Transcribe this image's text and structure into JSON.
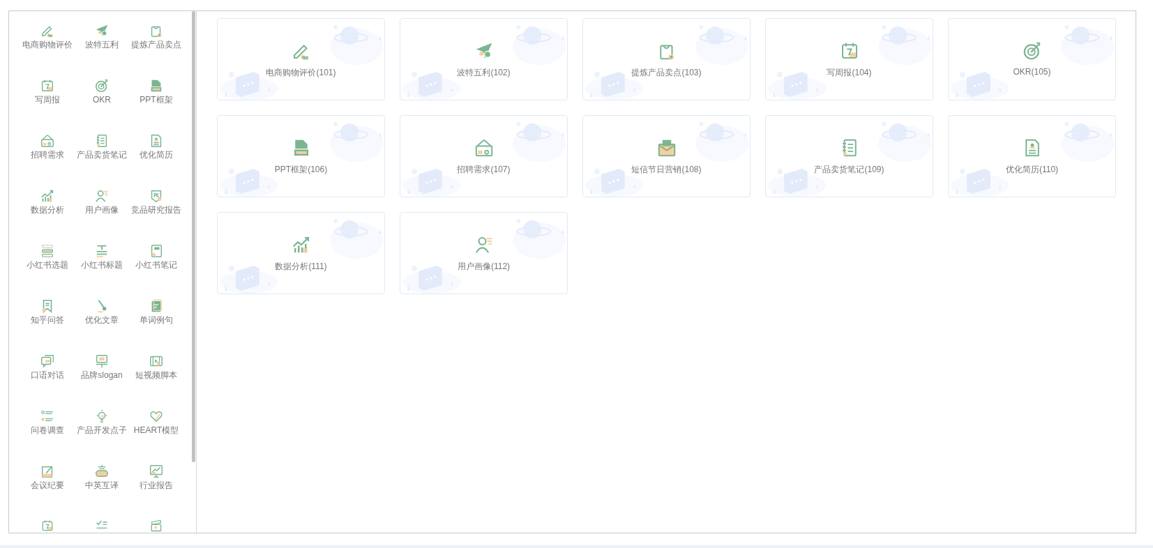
{
  "sidebar": {
    "items": [
      {
        "kind": "full",
        "label": "电商购物评价"
      },
      {
        "kind": "full",
        "label": "波特五利"
      },
      {
        "kind": "full",
        "label": "提炼产品卖点"
      },
      {
        "kind": "full",
        "label": "写周报"
      },
      {
        "kind": "full",
        "label": "OKR"
      },
      {
        "kind": "full",
        "label": "PPT框架"
      },
      {
        "kind": "full",
        "label": "招聘需求"
      },
      {
        "kind": "full",
        "label": "产品卖货笔记"
      },
      {
        "kind": "full",
        "label": "优化简历"
      },
      {
        "kind": "full",
        "label": "数据分析"
      },
      {
        "kind": "full",
        "label": "用户画像"
      },
      {
        "kind": "full",
        "label": "竞品研究报告"
      },
      {
        "kind": "full",
        "label": "小红书选题"
      },
      {
        "kind": "full",
        "label": "小红书标题"
      },
      {
        "kind": "full",
        "label": "小红书笔记"
      },
      {
        "kind": "full",
        "label": "知乎问答"
      },
      {
        "kind": "full",
        "label": "优化文章"
      },
      {
        "kind": "full",
        "label": "单词例句"
      },
      {
        "kind": "full",
        "label": "口语对话"
      },
      {
        "kind": "full",
        "label": "品牌slogan"
      },
      {
        "kind": "full",
        "label": "短视频脚本"
      },
      {
        "kind": "full",
        "label": "问卷调查"
      },
      {
        "kind": "full",
        "label": "产品开发点子"
      },
      {
        "kind": "full",
        "label": "HEART模型"
      },
      {
        "kind": "full",
        "label": "会议纪要"
      },
      {
        "kind": "full",
        "label": "中英互译"
      },
      {
        "kind": "full",
        "label": "行业报告"
      },
      {
        "kind": "cut"
      },
      {
        "kind": "cut"
      },
      {
        "kind": "cut"
      }
    ]
  },
  "cards": [
    {
      "label": "电商购物评价(101)"
    },
    {
      "label": "波特五利(102)"
    },
    {
      "label": "提炼产品卖点(103)"
    },
    {
      "label": "写周报(104)"
    },
    {
      "label": "OKR(105)"
    },
    {
      "label": "PPT框架(106)"
    },
    {
      "label": "招聘需求(107)"
    },
    {
      "label": "短信节日营销(108)"
    },
    {
      "label": "产品卖货笔记(109)"
    },
    {
      "label": "优化简历(110)"
    },
    {
      "label": "数据分析(111)"
    },
    {
      "label": "用户画像(112)"
    }
  ]
}
